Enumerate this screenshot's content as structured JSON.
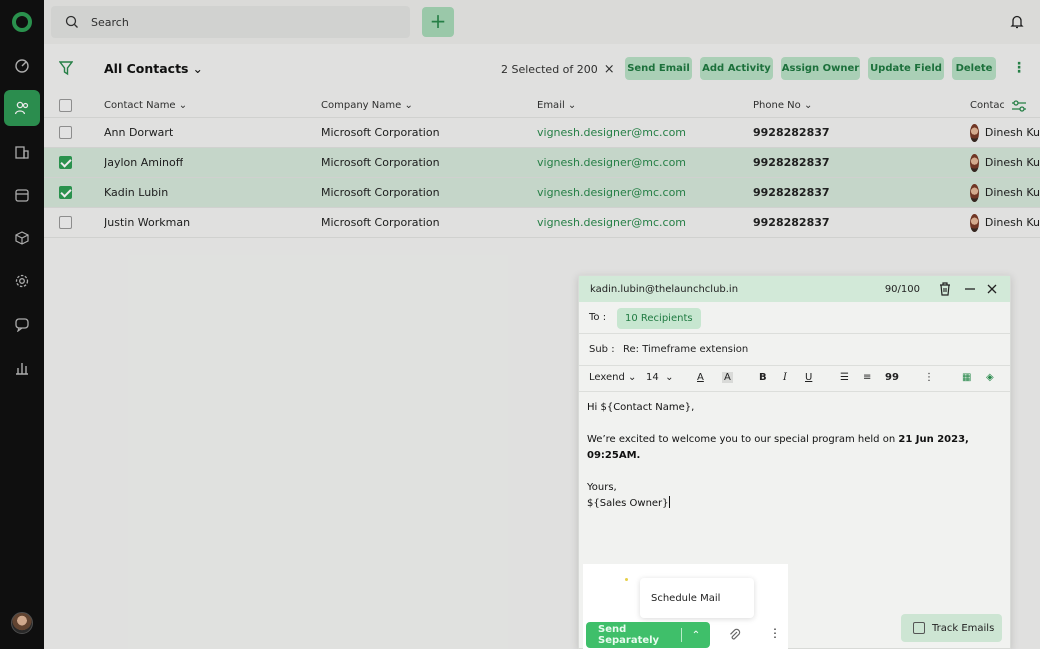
{
  "search": {
    "label": "Search"
  },
  "toolbar": {
    "view_title": "All Contacts",
    "selection_text": "2 Selected of 200",
    "actions": [
      "Send Email",
      "Add Activity",
      "Assign Owner",
      "Update Field",
      "Delete"
    ]
  },
  "table": {
    "headers": [
      "Contact Name",
      "Company Name",
      "Email",
      "Phone No",
      "Contac"
    ],
    "rows": [
      {
        "name": "Ann Dorwart",
        "company": "Microsoft Corporation",
        "email": "vignesh.designer@mc.com",
        "phone": "9928282837",
        "owner": "Dinesh Ku",
        "selected": false
      },
      {
        "name": "Jaylon Aminoff",
        "company": "Microsoft Corporation",
        "email": "vignesh.designer@mc.com",
        "phone": "9928282837",
        "owner": "Dinesh Ku",
        "selected": true
      },
      {
        "name": "Kadin Lubin",
        "company": "Microsoft Corporation",
        "email": "vignesh.designer@mc.com",
        "phone": "9928282837",
        "owner": "Dinesh Ku",
        "selected": true
      },
      {
        "name": "Justin Workman",
        "company": "Microsoft Corporation",
        "email": "vignesh.designer@mc.com",
        "phone": "9928282837",
        "owner": "Dinesh Ku",
        "selected": false
      }
    ]
  },
  "compose": {
    "from": "kadin.lubin@thelaunchclub.in",
    "char_count": "90/100",
    "to_label": "To :",
    "recipients": "10 Recipients",
    "sub_label": "Sub :",
    "subject": "Re: Timeframe extension",
    "font": "Lexend",
    "size": "14",
    "greeting": "Hi ${Contact Name},",
    "line1_pre": "We’re excited to welcome you to our special program held on ",
    "line1_bold": "21 Jun 2023, 09:25AM.",
    "closing": "Yours,",
    "signature": "${Sales Owner}",
    "schedule_label": "Schedule Mail",
    "send_label": "Send Separately",
    "track_label": "Track Emails"
  },
  "colors": {
    "brand_green": "#2e9e54",
    "selected_row": "#d6e9db",
    "sidebar": "#111111"
  }
}
